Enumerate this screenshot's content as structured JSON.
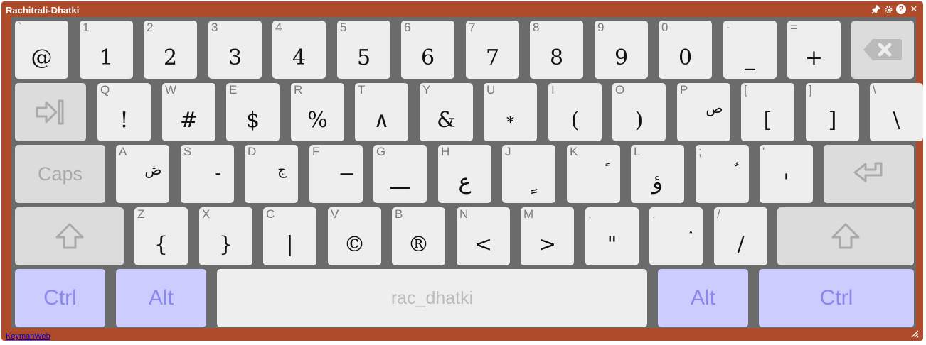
{
  "window": {
    "title": "Rachitrali-Dhatki",
    "footer_link": "KeymanWeb",
    "icons": [
      "pin-icon",
      "gear-icon",
      "help-icon",
      "close-icon"
    ],
    "frame_color": "#ad4b2a"
  },
  "keyboard": {
    "row1": [
      {
        "cap": "`",
        "glyph": "@"
      },
      {
        "cap": "1",
        "glyph": "1"
      },
      {
        "cap": "2",
        "glyph": "2"
      },
      {
        "cap": "3",
        "glyph": "3"
      },
      {
        "cap": "4",
        "glyph": "4"
      },
      {
        "cap": "5",
        "glyph": "5"
      },
      {
        "cap": "6",
        "glyph": "6"
      },
      {
        "cap": "7",
        "glyph": "7"
      },
      {
        "cap": "8",
        "glyph": "8"
      },
      {
        "cap": "9",
        "glyph": "9"
      },
      {
        "cap": "0",
        "glyph": "0"
      },
      {
        "cap": "-",
        "glyph": "_"
      },
      {
        "cap": "=",
        "glyph": "+"
      }
    ],
    "backspace_icon": "backspace-icon",
    "tab_icon": "tab-icon",
    "row2": [
      {
        "cap": "Q",
        "glyph": "!"
      },
      {
        "cap": "W",
        "glyph": "#"
      },
      {
        "cap": "E",
        "glyph": "$"
      },
      {
        "cap": "R",
        "glyph": "%"
      },
      {
        "cap": "T",
        "glyph": "∧"
      },
      {
        "cap": "Y",
        "glyph": "&"
      },
      {
        "cap": "U",
        "glyph": "*"
      },
      {
        "cap": "I",
        "glyph": "("
      },
      {
        "cap": "O",
        "glyph": ")"
      },
      {
        "cap": "P",
        "glyph": "ص"
      },
      {
        "cap": "[",
        "glyph": "["
      },
      {
        "cap": "]",
        "glyph": "]"
      },
      {
        "cap": "\\",
        "glyph": "\\"
      }
    ],
    "caps_label": "Caps",
    "row3": [
      {
        "cap": "A",
        "glyph": "ڞ"
      },
      {
        "cap": "S",
        "glyph": "ـ"
      },
      {
        "cap": "D",
        "glyph": "ڃ"
      },
      {
        "cap": "F",
        "glyph": "ـــ"
      },
      {
        "cap": "G",
        "glyph": "ـــ"
      },
      {
        "cap": "H",
        "glyph": "ع"
      },
      {
        "cap": "J",
        "glyph": "ٍ"
      },
      {
        "cap": "K",
        "glyph": "ً"
      },
      {
        "cap": "L",
        "glyph": "ؤ"
      },
      {
        "cap": ";",
        "glyph": "ٌ"
      },
      {
        "cap": "'",
        "glyph": "'"
      }
    ],
    "enter_icon": "enter-icon",
    "shift_icon": "shift-icon",
    "row4": [
      {
        "cap": "Z",
        "glyph": "{"
      },
      {
        "cap": "X",
        "glyph": "}"
      },
      {
        "cap": "C",
        "glyph": "|"
      },
      {
        "cap": "V",
        "glyph": "©"
      },
      {
        "cap": "B",
        "glyph": "®"
      },
      {
        "cap": "N",
        "glyph": "<"
      },
      {
        "cap": "M",
        "glyph": ">"
      },
      {
        "cap": ",",
        "glyph": "\""
      },
      {
        "cap": ".",
        "glyph": "ٛ"
      },
      {
        "cap": "/",
        "glyph": "/"
      }
    ],
    "row5": {
      "ctrl_left": "Ctrl",
      "alt_left": "Alt",
      "space": "rac_dhatki",
      "alt_right": "Alt",
      "ctrl_right": "Ctrl"
    },
    "colors": {
      "key": "#eeeeee",
      "special_key": "#dcdcdc",
      "modifier_key": "#ccccff",
      "modifier_text": "#8888ee",
      "background": "#6b6b6b"
    }
  }
}
